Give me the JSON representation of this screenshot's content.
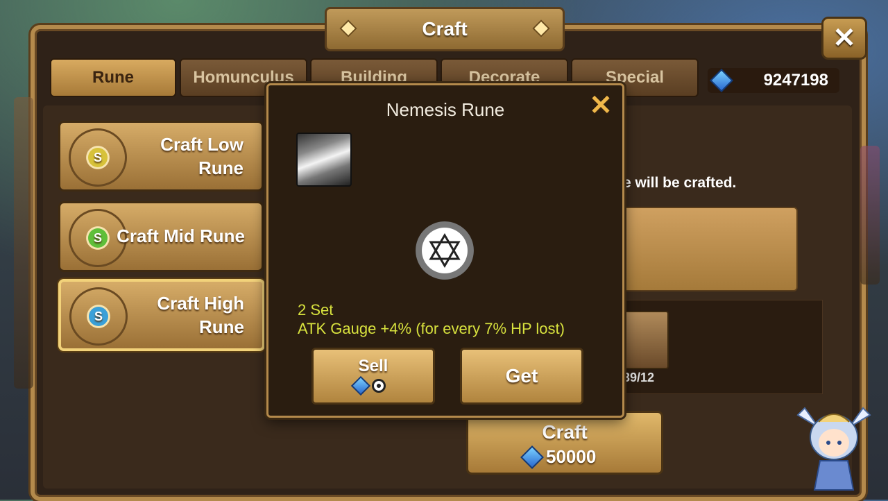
{
  "window": {
    "title": "Craft",
    "close_label": "✕"
  },
  "tabs": [
    {
      "label": "Rune",
      "active": true
    },
    {
      "label": "Homunculus",
      "active": false
    },
    {
      "label": "Building",
      "active": false
    },
    {
      "label": "Decorate",
      "active": false
    },
    {
      "label": "Special",
      "active": false
    }
  ],
  "currency": {
    "crystals": "9247198",
    "icon": "crystal-icon"
  },
  "side_menu": [
    {
      "label_line1": "Craft Low",
      "label_line2": "Rune",
      "emblem_color": "#d7c23a"
    },
    {
      "label_line1": "Craft Mid Rune",
      "label_line2": "",
      "emblem_color": "#5fbf3a"
    },
    {
      "label_line1": "Craft High",
      "label_line2": "Rune",
      "emblem_color": "#3aa0d8",
      "active": true
    }
  ],
  "background_panel": {
    "description_fragment": "e will be crafted.",
    "material_count": "39/12",
    "craft_button": {
      "label": "Craft",
      "cost": "50000"
    }
  },
  "popup": {
    "title": "Nemesis Rune",
    "close_label": "✕",
    "set_line": "2 Set",
    "effect_line": "ATK Gauge +4% (for every 7% HP lost)",
    "sell_label": "Sell",
    "get_label": "Get"
  },
  "colors": {
    "accent_gold": "#b48a4c",
    "effect_text": "#d8e23e",
    "popup_bg": "#2a1d10"
  }
}
